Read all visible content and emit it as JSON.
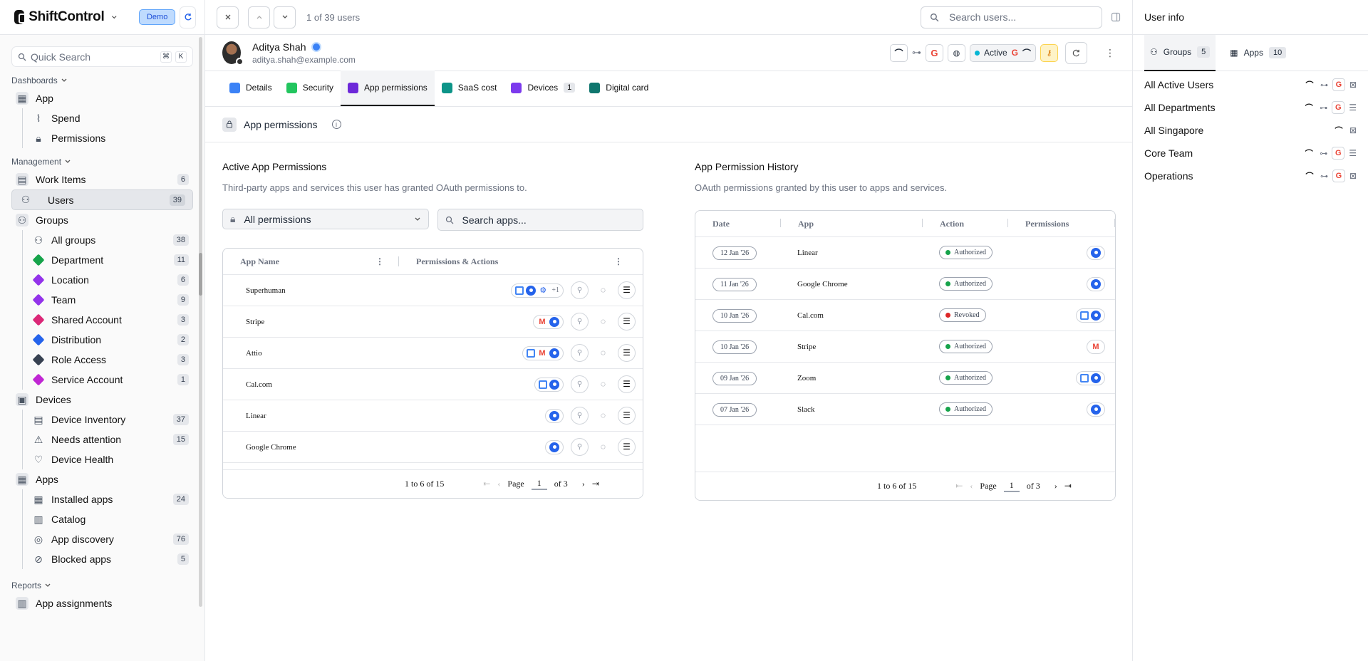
{
  "brand": {
    "name": "ShiftControl",
    "demo_label": "Demo"
  },
  "sidebar": {
    "quick_search": "Quick Search",
    "shortcut": [
      "⌘",
      "K"
    ],
    "sections": {
      "dashboards": "Dashboards",
      "management": "Management",
      "reports": "Reports"
    },
    "dash_app": "App",
    "dash_sub": [
      {
        "label": "Spend"
      },
      {
        "label": "Permissions"
      }
    ],
    "work_items": {
      "label": "Work Items",
      "count": "6"
    },
    "users": {
      "label": "Users",
      "count": "39"
    },
    "groups": {
      "label": "Groups"
    },
    "group_items": [
      {
        "label": "All groups",
        "count": "38",
        "color": ""
      },
      {
        "label": "Department",
        "count": "11",
        "color": "#16a34a"
      },
      {
        "label": "Location",
        "count": "6",
        "color": "#9333ea"
      },
      {
        "label": "Team",
        "count": "9",
        "color": "#9333ea"
      },
      {
        "label": "Shared Account",
        "count": "3",
        "color": "#db2777"
      },
      {
        "label": "Distribution",
        "count": "2",
        "color": "#2563eb"
      },
      {
        "label": "Role Access",
        "count": "3",
        "color": "#374151"
      },
      {
        "label": "Service Account",
        "count": "1",
        "color": "#c026d3"
      }
    ],
    "devices": {
      "label": "Devices"
    },
    "device_items": [
      {
        "label": "Device Inventory",
        "count": "37"
      },
      {
        "label": "Needs attention",
        "count": "15"
      },
      {
        "label": "Device Health",
        "count": ""
      }
    ],
    "apps": {
      "label": "Apps"
    },
    "app_items": [
      {
        "label": "Installed apps",
        "count": "24"
      },
      {
        "label": "Catalog",
        "count": ""
      },
      {
        "label": "App discovery",
        "count": "76"
      },
      {
        "label": "Blocked apps",
        "count": "5"
      }
    ],
    "reports_item": "App assignments"
  },
  "topbar": {
    "position": "1 of 39 users",
    "search_placeholder": "Search users..."
  },
  "user": {
    "name": "Aditya Shah",
    "email": "aditya.shah@example.com",
    "status": "Active"
  },
  "tabs": [
    {
      "label": "Details",
      "color": "#3b82f6"
    },
    {
      "label": "Security",
      "color": "#22c55e"
    },
    {
      "label": "App permissions",
      "color": "#6d28d9"
    },
    {
      "label": "SaaS cost",
      "color": "#0d9488"
    },
    {
      "label": "Devices",
      "color": "#7c3aed",
      "count": "1"
    },
    {
      "label": "Digital card",
      "color": "#0f766e"
    }
  ],
  "section_title": "App permissions",
  "active": {
    "title": "Active App Permissions",
    "desc": "Third-party apps and services this user has granted OAuth permissions to.",
    "filter": "All permissions",
    "search_placeholder": "Search apps...",
    "col_app": "App Name",
    "col_perm": "Permissions & Actions",
    "rows": [
      {
        "app": "Superhuman",
        "extra": "+1"
      },
      {
        "app": "Stripe"
      },
      {
        "app": "Attio"
      },
      {
        "app": "Cal.com"
      },
      {
        "app": "Linear"
      },
      {
        "app": "Google Chrome"
      }
    ],
    "footer": {
      "range": "1 to 6 of 15",
      "page_label": "Page",
      "page": "1",
      "of": "of 3"
    }
  },
  "history": {
    "title": "App Permission History",
    "desc": "OAuth permissions granted by this user to apps and services.",
    "cols": [
      "Date",
      "App",
      "Action",
      "Permissions"
    ],
    "rows": [
      {
        "date": "12 Jan '26",
        "app": "Linear",
        "action": "Authorized"
      },
      {
        "date": "11 Jan '26",
        "app": "Google Chrome",
        "action": "Authorized"
      },
      {
        "date": "10 Jan '26",
        "app": "Cal.com",
        "action": "Revoked"
      },
      {
        "date": "10 Jan '26",
        "app": "Stripe",
        "action": "Authorized"
      },
      {
        "date": "09 Jan '26",
        "app": "Zoom",
        "action": "Authorized"
      },
      {
        "date": "07 Jan '26",
        "app": "Slack",
        "action": "Authorized"
      }
    ],
    "footer": {
      "range": "1 to 6 of 15",
      "page_label": "Page",
      "page": "1",
      "of": "of 3"
    }
  },
  "rpanel": {
    "title": "User info",
    "tabs": [
      {
        "label": "Groups",
        "count": "5"
      },
      {
        "label": "Apps",
        "count": "10"
      }
    ],
    "groups": [
      {
        "label": "All Active Users"
      },
      {
        "label": "All Departments"
      },
      {
        "label": "All Singapore"
      },
      {
        "label": "Core Team"
      },
      {
        "label": "Operations"
      }
    ]
  }
}
